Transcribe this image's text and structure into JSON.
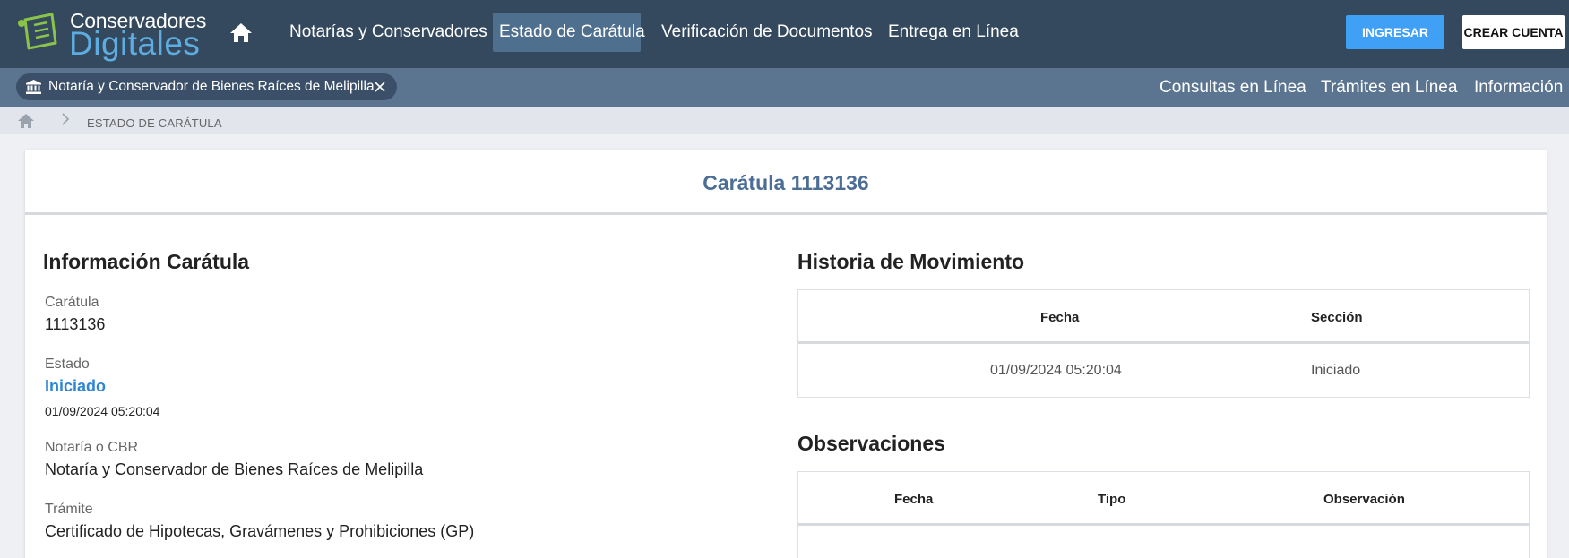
{
  "header": {
    "logo_line1": "Conservadores",
    "logo_line2": "Digitales",
    "nav": [
      "Notarías y Conservadores",
      "Estado de Carátula",
      "Verificación de Documentos",
      "Entrega en Línea"
    ],
    "active_nav": "Estado de Carátula",
    "login_label": "INGRESAR",
    "signup_label": "CREAR CUENTA"
  },
  "subbar": {
    "selected_office": "Notaría y Conservador de Bienes Raíces de Melipilla",
    "links": [
      "Consultas en Línea",
      "Trámites en Línea",
      "Información"
    ]
  },
  "breadcrumb": {
    "current": "ESTADO DE CARÁTULA"
  },
  "card": {
    "title": "Carátula 1113136"
  },
  "info": {
    "title": "Información Carátula",
    "fields": [
      {
        "label": "Carátula",
        "value": "1113136"
      },
      {
        "label": "Estado",
        "value": "Iniciado",
        "date": "01/09/2024 05:20:04"
      },
      {
        "label": "Notaría o CBR",
        "value": "Notaría y Conservador de Bienes Raíces de Melipilla"
      },
      {
        "label": "Trámite",
        "value": "Certificado de Hipotecas, Gravámenes y Prohibiciones (GP)"
      }
    ]
  },
  "history": {
    "title": "Historia de Movimiento",
    "columns": [
      "Fecha",
      "Sección"
    ],
    "rows": [
      [
        "01/09/2024 05:20:04",
        "Iniciado"
      ]
    ]
  },
  "observations": {
    "title": "Observaciones",
    "columns": [
      "Fecha",
      "Tipo",
      "Observación"
    ],
    "rows": []
  },
  "colors": {
    "topbar": "#34495e",
    "subbar": "#5b7591",
    "accent": "#3fa0f5",
    "status": "#2f86d6",
    "title": "#4c6e96"
  }
}
